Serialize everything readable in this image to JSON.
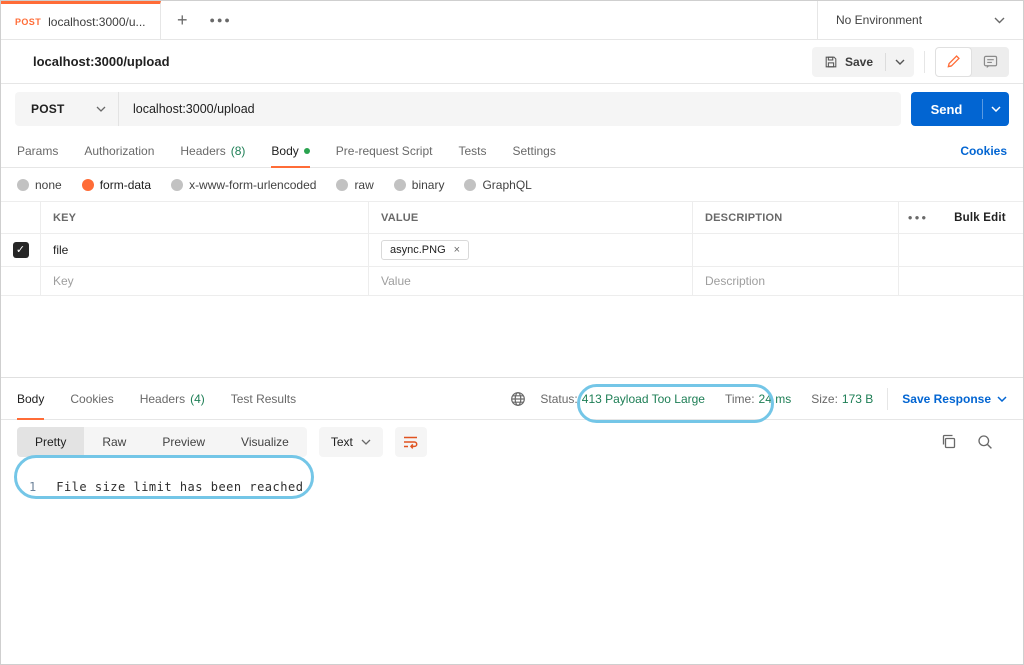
{
  "colors": {
    "brand_orange": "#ff6c37",
    "link_blue": "#0265d2",
    "status_green": "#1d7e55",
    "send_button_blue": "#0265d2",
    "annotation_blue": "#74c6e7"
  },
  "tabbar": {
    "tab": {
      "method": "POST",
      "title": "localhost:3000/u..."
    },
    "environment": {
      "label": "No Environment"
    }
  },
  "request_header": {
    "title": "localhost:3000/upload",
    "save_label": "Save"
  },
  "url_bar": {
    "method": "POST",
    "url": "localhost:3000/upload",
    "send_label": "Send"
  },
  "request_tabs": {
    "items": [
      {
        "label": "Params"
      },
      {
        "label": "Authorization"
      },
      {
        "label": "Headers",
        "count": "(8)"
      },
      {
        "label": "Body"
      },
      {
        "label": "Pre-request Script"
      },
      {
        "label": "Tests"
      },
      {
        "label": "Settings"
      }
    ],
    "active": "Body",
    "cookies_link": "Cookies"
  },
  "body_types": {
    "options": [
      "none",
      "form-data",
      "x-www-form-urlencoded",
      "raw",
      "binary",
      "GraphQL"
    ],
    "selected": "form-data"
  },
  "form_table": {
    "headers": {
      "key": "KEY",
      "value": "VALUE",
      "description": "DESCRIPTION",
      "bulk_edit": "Bulk Edit"
    },
    "row": {
      "checked": true,
      "key": "file",
      "value_chip": "async.PNG",
      "remove": "×"
    },
    "placeholder_row": {
      "key": "Key",
      "value": "Value",
      "description": "Description"
    }
  },
  "response": {
    "tabs": [
      {
        "label": "Body"
      },
      {
        "label": "Cookies"
      },
      {
        "label": "Headers",
        "count": "(4)"
      },
      {
        "label": "Test Results"
      }
    ],
    "active": "Body",
    "meta": {
      "status_label": "Status:",
      "status_value": "413 Payload Too Large",
      "time_label": "Time:",
      "time_value": "24 ms",
      "size_label": "Size:",
      "size_value": "173 B",
      "save_response": "Save Response"
    },
    "view_tabs": [
      "Pretty",
      "Raw",
      "Preview",
      "Visualize"
    ],
    "active_view": "Pretty",
    "format": "Text",
    "body": {
      "line_number": "1",
      "line_text": "File size limit has been reached"
    }
  }
}
